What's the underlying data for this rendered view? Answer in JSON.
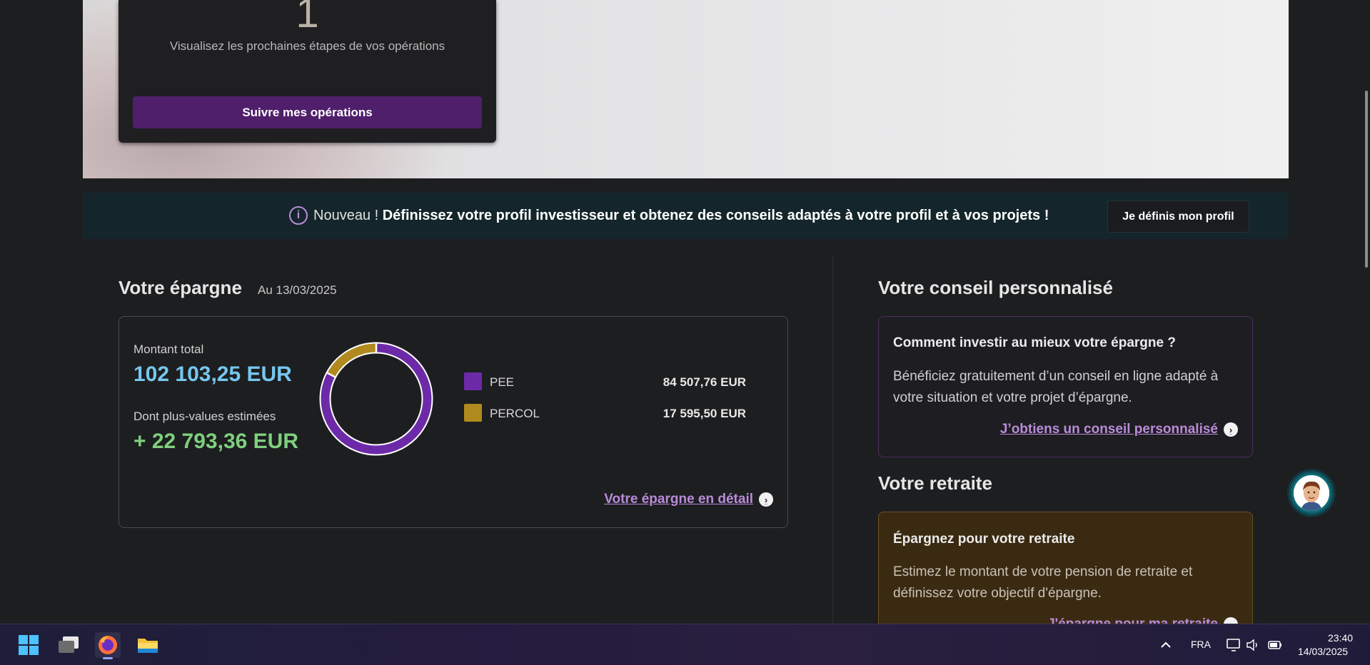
{
  "hero": {
    "count": "1",
    "description": "Visualisez les prochaines étapes de vos opérations",
    "button_label": "Suivre mes opérations"
  },
  "banner": {
    "lead": "Nouveau ! ",
    "message": "Définissez votre profil investisseur et obtenez des conseils adaptés à votre profil et à vos projets !",
    "button_label": "Je définis mon profil",
    "icon": "info-icon"
  },
  "savings": {
    "title": "Votre épargne",
    "date": "Au 13/03/2025",
    "total_label": "Montant total",
    "total_value": "102 103,25 EUR",
    "gains_label": "Dont plus-values estimées",
    "gains_value": "+ 22 793,36 EUR",
    "items": [
      {
        "name": "PEE",
        "value": "84 507,76 EUR",
        "color": "#6d2aa8"
      },
      {
        "name": "PERCOL",
        "value": "17 595,50 EUR",
        "color": "#b08a1e"
      }
    ],
    "detail_link": "Votre épargne en détail"
  },
  "chart_data": {
    "type": "pie",
    "categories": [
      "PEE",
      "PERCOL"
    ],
    "values": [
      84507.76,
      17595.5
    ],
    "colors": [
      "#6d2aa8",
      "#b08a1e"
    ]
  },
  "advice": {
    "title": "Votre conseil personnalisé",
    "heading": "Comment investir au mieux votre épargne ?",
    "text": "Bénéficiez gratuitement d’un conseil en ligne adapté à votre situation et votre projet d’épargne.",
    "link": "J’obtiens un conseil personnalisé"
  },
  "retirement": {
    "title": "Votre retraite",
    "heading": "Épargnez pour votre retraite",
    "text": "Estimez le montant de votre pension de retraite et définissez votre objectif d'épargne.",
    "link": "J'épargne pour ma retraite"
  },
  "taskbar": {
    "apps": [
      "windows-start-icon",
      "task-view-icon",
      "firefox-icon",
      "file-explorer-icon"
    ],
    "language": "FRA",
    "time": "23:40",
    "date": "14/03/2025"
  },
  "colors": {
    "accent_purple": "#b98bd9",
    "total_blue": "#76c7ee",
    "gains_green": "#7fcf7e"
  }
}
